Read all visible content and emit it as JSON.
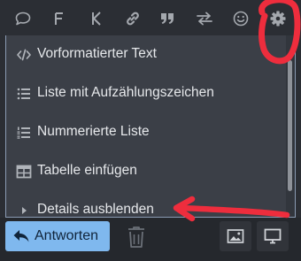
{
  "toolbar": {
    "buttons": [
      {
        "name": "quote-bubble",
        "icon": "speech-bubble-icon"
      },
      {
        "name": "format-bold",
        "label": "F",
        "icon": "bold-icon"
      },
      {
        "name": "format-italic",
        "label": "K",
        "icon": "italic-icon"
      },
      {
        "name": "insert-link",
        "icon": "link-icon"
      },
      {
        "name": "blockquote",
        "icon": "quote-icon"
      },
      {
        "name": "switch-editor",
        "icon": "swap-arrows-icon"
      },
      {
        "name": "insert-emoji",
        "icon": "smiley-icon"
      },
      {
        "name": "options",
        "icon": "gear-icon"
      }
    ]
  },
  "options_menu": {
    "items": [
      {
        "label": "Vorformatierter Text",
        "icon": "code-icon"
      },
      {
        "label": "Liste mit Aufzählungszeichen",
        "icon": "bullet-list-icon"
      },
      {
        "label": "Nummerierte Liste",
        "icon": "numbered-list-icon"
      },
      {
        "label": "Tabelle einfügen",
        "icon": "table-icon"
      },
      {
        "label": "Details ausblenden",
        "icon": "caret-right-icon"
      }
    ]
  },
  "footer": {
    "reply_label": "Antworten",
    "reply_icon": "reply-arrow-icon",
    "trash_icon": "trash-icon",
    "image_icon": "image-icon",
    "preview_icon": "monitor-icon"
  },
  "colors": {
    "background": "#2b2e34",
    "menu_background": "#3b3f47",
    "primary_button": "#7fb8ee",
    "icon_gray": "#a4a8ae",
    "annotation_red": "#ee2d3d"
  }
}
